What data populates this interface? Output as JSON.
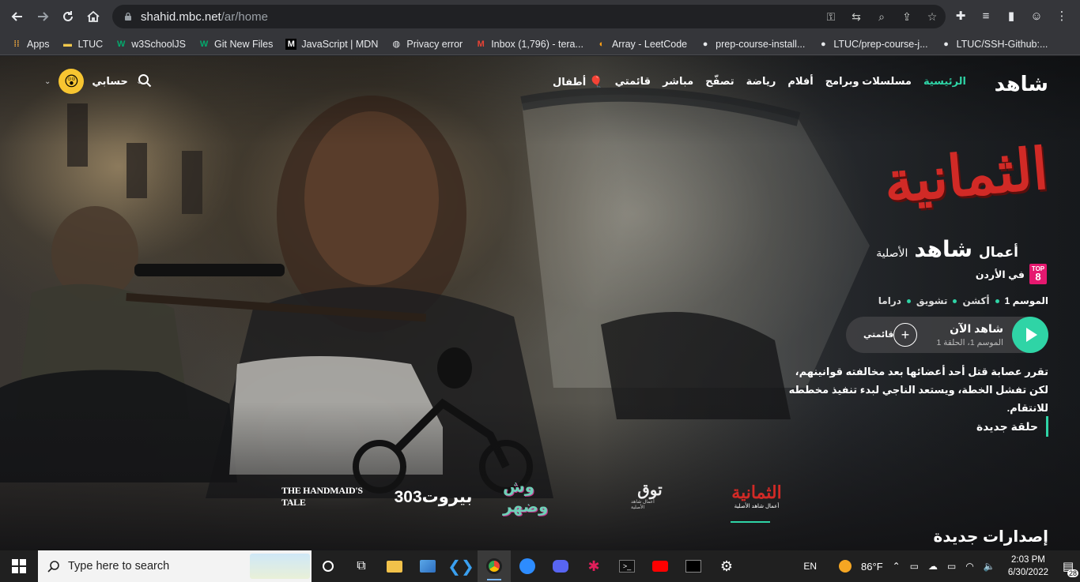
{
  "browser": {
    "url_host": "shahid.mbc.net",
    "url_path": "/ar/home",
    "bookmarks": [
      "Apps",
      "LTUC",
      "w3SchoolJS",
      "Git New Files",
      "JavaScript | MDN",
      "Privacy error",
      "Inbox (1,796) - tera...",
      "Array - LeetCode",
      "prep-course-install...",
      "LTUC/prep-course-j...",
      "LTUC/SSH-Github:..."
    ]
  },
  "site": {
    "logo": "شاهد",
    "menu": [
      "الرئيسية",
      "مسلسلات وبرامج",
      "أفلام",
      "رياضة",
      "تصفّح",
      "مباشر",
      "قائمتي",
      "أطفال"
    ],
    "account_label": "حسابي"
  },
  "hero": {
    "title": "الثمانية",
    "originals_prefix": "أعمال",
    "originals_brand": "شاهد",
    "originals_suffix": "الأصلية",
    "top_badge_top": "TOP",
    "top_badge_num": "8",
    "top_label": "في الأردن",
    "season": "الموسم 1",
    "genres": [
      "أكشن",
      "تشويق",
      "دراما"
    ],
    "watch_label": "شاهد الآن",
    "episode_label": "الموسم 1، الحلقة 1",
    "mylist_label": "قائمتي",
    "synopsis": "تقرر عصابة قتل أحد أعضائها بعد مخالفته قوانينهم، لكن تفشل الخطة، ويستعد الناجي لبدء تنفيذ مخططه للانتقام.",
    "new_episode": "حلقة جديدة"
  },
  "rail": {
    "items": [
      "THE HANDMAID'S TALE",
      "بيروت303",
      "وش وضهر",
      "توق",
      "الثمانية"
    ],
    "first_subtitle": "أعمال شاهد الأصلية",
    "fourth_subtitle": "أعمال شاهد الأصلية"
  },
  "section_title": "إصدارات جديدة",
  "taskbar": {
    "search_placeholder": "Type here to search",
    "lang": "EN",
    "temp": "86°F",
    "time": "2:03 PM",
    "date": "6/30/2022",
    "notif_count": "28"
  }
}
